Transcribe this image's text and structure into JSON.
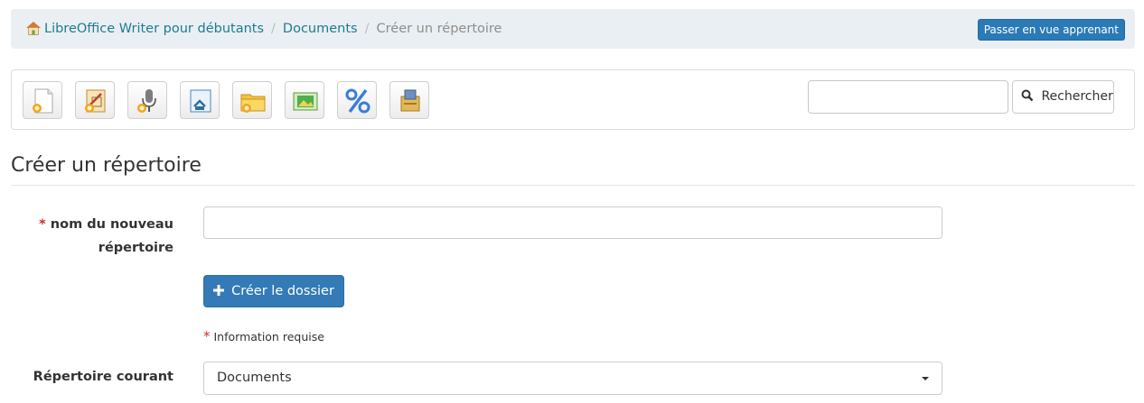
{
  "breadcrumb": {
    "home_icon": "home-icon",
    "items": [
      "LibreOffice Writer pour débutants",
      "Documents"
    ],
    "current": "Créer un répertoire",
    "separator": "/"
  },
  "learner_view_button": "Passer en vue apprenant",
  "toolbar": {
    "tools": [
      "new-document-icon",
      "new-drawing-icon",
      "audio-record-icon",
      "upload-icon",
      "new-folder-icon",
      "slideshow-icon",
      "quota-icon",
      "certificate-icon"
    ],
    "search_placeholder": "",
    "search_label": "Rechercher"
  },
  "page_title": "Créer un répertoire",
  "form": {
    "required_mark": "*",
    "folder_name_label": "nom du nouveau répertoire",
    "folder_name_value": "",
    "create_button": "Créer le dossier",
    "required_info": "Information requise",
    "current_dir_label": "Répertoire courant",
    "current_dir_value": "Documents"
  },
  "colors": {
    "link": "#1f7b8f",
    "primary": "#337ab7",
    "required": "#c9302c",
    "breadcrumb_bg": "#eaeff3"
  }
}
